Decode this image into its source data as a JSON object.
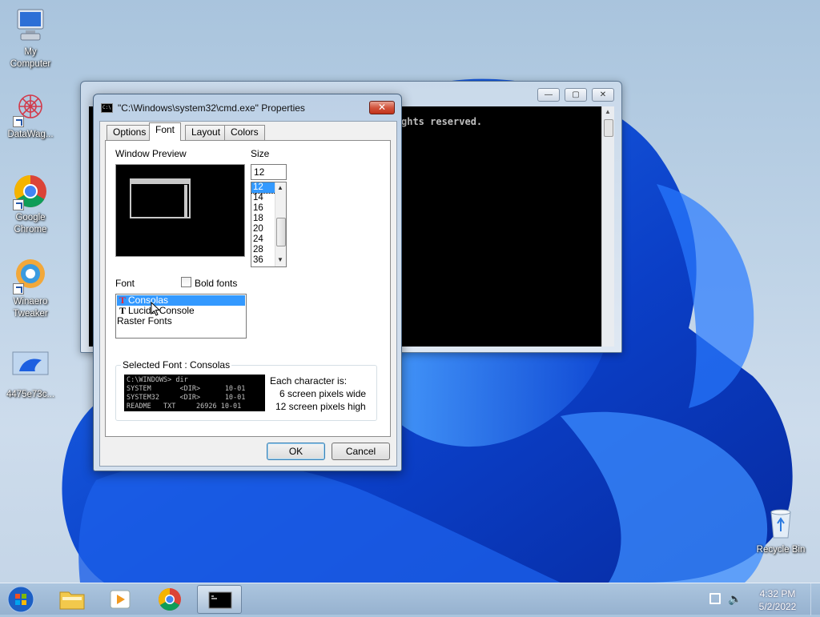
{
  "desktop": {
    "icons": [
      {
        "label_line1": "My",
        "label_line2": "Computer"
      },
      {
        "label_line1": "DataWag...",
        "label_line2": ""
      },
      {
        "label_line1": "Google",
        "label_line2": "Chrome"
      },
      {
        "label_line1": "Winaero",
        "label_line2": "Tweaker"
      },
      {
        "label_line1": "4475e73c...",
        "label_line2": ""
      },
      {
        "label_line1": "Recycle Bin",
        "label_line2": ""
      }
    ]
  },
  "console": {
    "text": "ghts reserved.",
    "btn_minimize": "—",
    "btn_maximize": "▢",
    "btn_close": "✕"
  },
  "dialog": {
    "title": "\"C:\\Windows\\system32\\cmd.exe\" Properties",
    "close": "✕",
    "tabs": [
      "Options",
      "Font",
      "Layout",
      "Colors"
    ],
    "active_tab": "Font",
    "window_preview_label": "Window Preview",
    "size_label": "Size",
    "size_value": "12",
    "size_options": [
      "12",
      "14",
      "16",
      "18",
      "20",
      "24",
      "28",
      "36"
    ],
    "font_label": "Font",
    "bold_fonts_label": "Bold fonts",
    "fonts": [
      {
        "icon": "T",
        "name": "Consolas"
      },
      {
        "icon": "T",
        "name": "Lucida Console"
      },
      {
        "icon": "",
        "name": "Raster Fonts"
      }
    ],
    "selected_font_label": "Selected Font : Consolas",
    "sample_lines": [
      "C:\\WINDOWS> dir",
      "SYSTEM       <DIR>      10-01",
      "SYSTEM32     <DIR>      10-01",
      "README   TXT     26926 10-01"
    ],
    "char_info": {
      "heading": "Each character is:",
      "width_line": "6 screen pixels wide",
      "height_line": "12 screen pixels high"
    },
    "ok": "OK",
    "cancel": "Cancel"
  },
  "taskbar": {
    "time": "4:32 PM",
    "date": "5/2/2022"
  },
  "colors": {
    "selection": "#3399ff",
    "close_red": "#c2321a"
  }
}
